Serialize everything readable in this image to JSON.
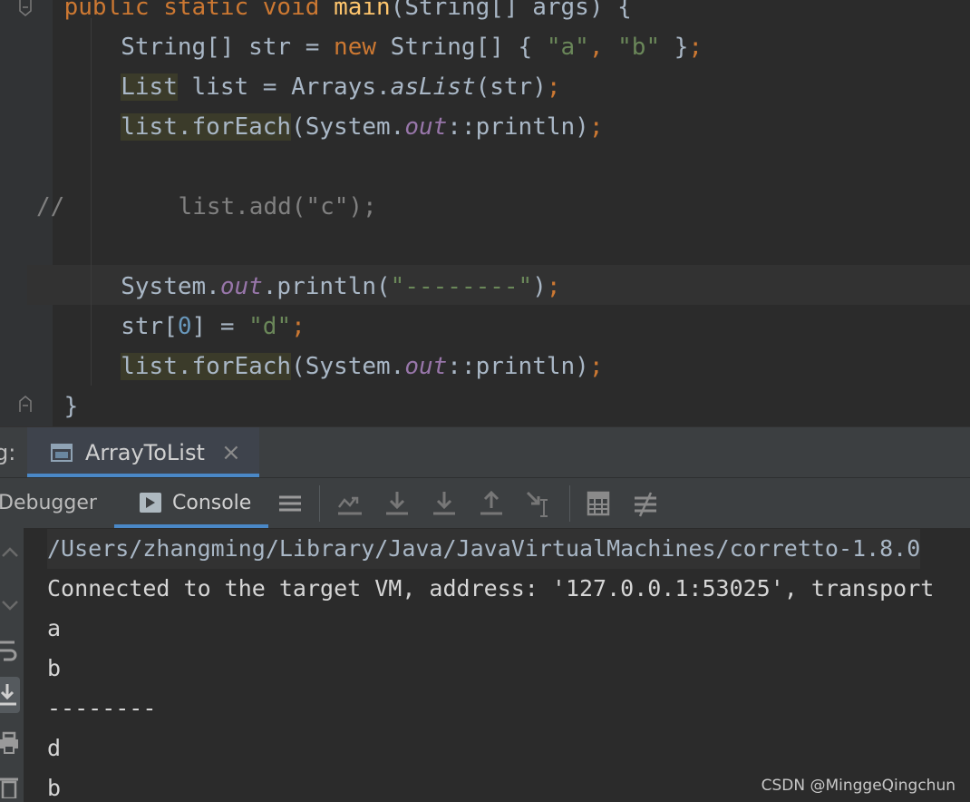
{
  "editor": {
    "lines": [
      [
        {
          "t": "    ",
          "c": ""
        },
        {
          "t": "public",
          "c": "kw"
        },
        {
          "t": " ",
          "c": ""
        },
        {
          "t": "static",
          "c": "kw"
        },
        {
          "t": " ",
          "c": ""
        },
        {
          "t": "void",
          "c": "kw"
        },
        {
          "t": " ",
          "c": ""
        },
        {
          "t": "main",
          "c": "fn"
        },
        {
          "t": "(String[] args) {",
          "c": ""
        }
      ],
      [
        {
          "t": "        ",
          "c": ""
        },
        {
          "t": "String[] str = ",
          "c": ""
        },
        {
          "t": "new",
          "c": "kw"
        },
        {
          "t": " String[] { ",
          "c": ""
        },
        {
          "t": "\"a\"",
          "c": "str"
        },
        {
          "t": ", ",
          "c": "kw"
        },
        {
          "t": "\"b\"",
          "c": "str"
        },
        {
          "t": " }",
          "c": ""
        },
        {
          "t": ";",
          "c": "kw"
        }
      ],
      [
        {
          "t": "        ",
          "c": ""
        },
        {
          "t": "List",
          "c": "hl"
        },
        {
          "t": " list = Arrays.",
          "c": ""
        },
        {
          "t": "asList",
          "c": "itp"
        },
        {
          "t": "(str)",
          "c": ""
        },
        {
          "t": ";",
          "c": "kw"
        }
      ],
      [
        {
          "t": "        ",
          "c": ""
        },
        {
          "t": "list.forEach",
          "c": "hl"
        },
        {
          "t": "(System.",
          "c": ""
        },
        {
          "t": "out",
          "c": "ital"
        },
        {
          "t": "::println)",
          "c": ""
        },
        {
          "t": ";",
          "c": "kw"
        }
      ],
      [],
      [
        {
          "t": "//",
          "c": "cm"
        },
        {
          "t": "        list.add(\"c\");",
          "c": "cm"
        }
      ],
      [],
      [
        {
          "t": "        ",
          "c": ""
        },
        {
          "t": "System.",
          "c": ""
        },
        {
          "t": "out",
          "c": "ital"
        },
        {
          "t": ".println(",
          "c": ""
        },
        {
          "t": "\"--------\"",
          "c": "str"
        },
        {
          "t": ")",
          "c": ""
        },
        {
          "t": ";",
          "c": "kw"
        }
      ],
      [
        {
          "t": "        ",
          "c": ""
        },
        {
          "t": "str[",
          "c": ""
        },
        {
          "t": "0",
          "c": "num"
        },
        {
          "t": "] = ",
          "c": ""
        },
        {
          "t": "\"d\"",
          "c": "str"
        },
        {
          "t": ";",
          "c": "kw"
        }
      ],
      [
        {
          "t": "        ",
          "c": ""
        },
        {
          "t": "list.forEach",
          "c": "hl"
        },
        {
          "t": "(System.",
          "c": ""
        },
        {
          "t": "out",
          "c": "ital"
        },
        {
          "t": "::println)",
          "c": ""
        },
        {
          "t": ";",
          "c": "kw"
        }
      ],
      [
        {
          "t": "    }",
          "c": ""
        }
      ]
    ]
  },
  "toolwindow": {
    "label": "g:",
    "run_tab": "ArrayToList",
    "close_glyph": "×"
  },
  "debugger": {
    "debugger_tab": "Debugger",
    "console_tab": "Console"
  },
  "console": {
    "lines": [
      "/Users/zhangming/Library/Java/JavaVirtualMachines/corretto-1.8.0",
      "Connected to the target VM, address: '127.0.0.1:53025', transport",
      "a",
      "b",
      "--------",
      "d",
      "b"
    ]
  },
  "watermark": "CSDN @MinggeQingchun",
  "colors": {
    "editor_bg": "#2b2b2b",
    "keyword": "#cc7832",
    "string": "#6a8759",
    "method_decl": "#ffc66d",
    "static_field": "#9876aa",
    "accent_underline": "#4a88c7"
  }
}
